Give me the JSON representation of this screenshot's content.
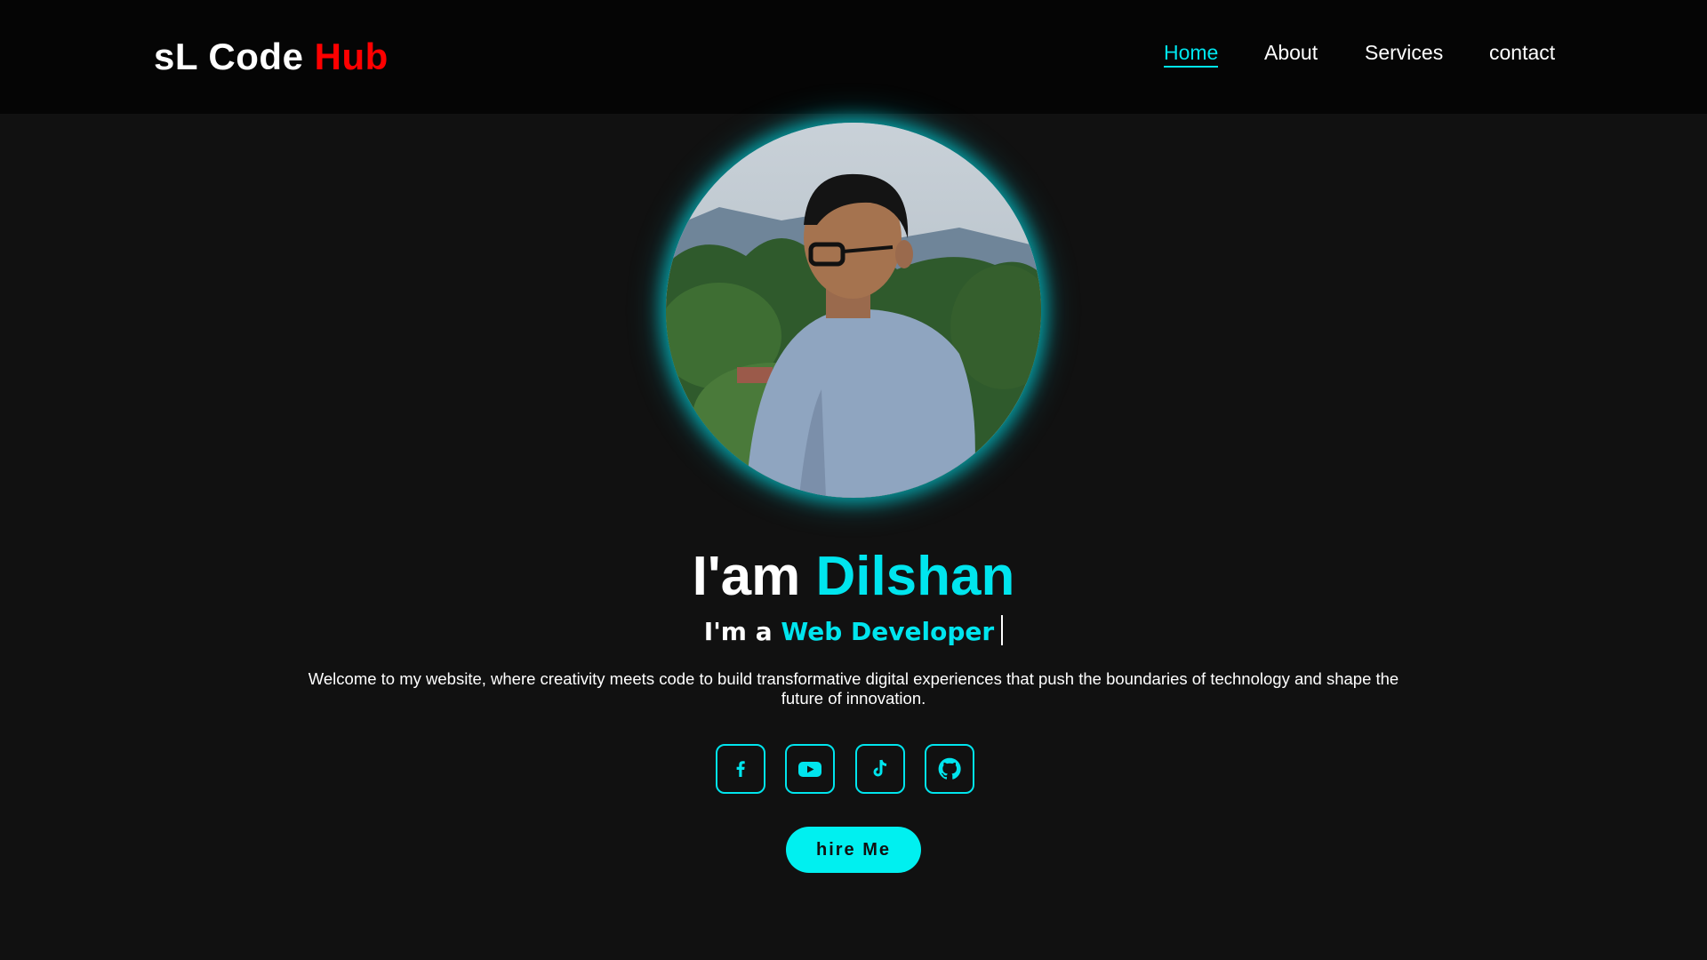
{
  "brand": {
    "part1": "sL Code",
    "part2": "Hub",
    "accent_color": "#ff0000"
  },
  "nav": {
    "items": [
      {
        "label": "Home",
        "active": true
      },
      {
        "label": "About",
        "active": false
      },
      {
        "label": "Services",
        "active": false
      },
      {
        "label": "contact",
        "active": false
      }
    ]
  },
  "hero": {
    "avatar_alt": "profile photo",
    "heading_prefix": "I'am",
    "heading_name": "Dilshan",
    "sub_prefix": "I'm a",
    "sub_role": "Web Developer",
    "intro": "Welcome to my website, where creativity meets code to build transformative digital experiences that push the boundaries of technology and shape the future of innovation.",
    "socials": [
      {
        "icon": "facebook-icon"
      },
      {
        "icon": "youtube-icon"
      },
      {
        "icon": "tiktok-icon"
      },
      {
        "icon": "github-icon"
      }
    ],
    "hire_label": "hire Me"
  },
  "colors": {
    "accent": "#00e5ee",
    "background": "#111111",
    "header": "#050505"
  }
}
